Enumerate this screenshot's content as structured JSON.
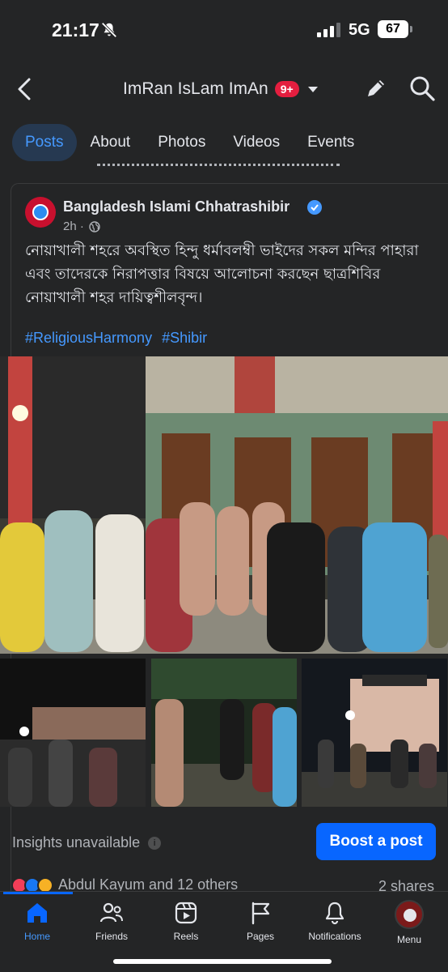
{
  "status": {
    "time": "21:17",
    "network": "5G",
    "battery": "67"
  },
  "header": {
    "title": "ImRan IsLam ImAn",
    "badge": "9+"
  },
  "tabs": [
    "Posts",
    "About",
    "Photos",
    "Videos",
    "Events"
  ],
  "post": {
    "author": "Bangladesh Islami Chhatrashibir",
    "time": "2h ·",
    "text": "নোয়াখালী শহরে অবস্থিত হিন্দু ধর্মাবলম্বী ভাইদের সকল মন্দির পাহারা এবং তাদেরকে নিরাপত্তার বিষয়ে আলোচনা করছেন ছাত্রশিবির নোয়াখালী শহর দায়িত্বশীলবৃন্দ।",
    "hashtags": [
      "#ReligiousHarmony",
      "#Shibir"
    ]
  },
  "insights": {
    "text": "Insights unavailable",
    "boost_label": "Boost a post"
  },
  "reactions": {
    "text": "Abdul Kayum and 12 others",
    "shares": "2 shares"
  },
  "nav": {
    "items": [
      {
        "label": "Home",
        "icon": "home-icon"
      },
      {
        "label": "Friends",
        "icon": "friends-icon"
      },
      {
        "label": "Reels",
        "icon": "reels-icon"
      },
      {
        "label": "Pages",
        "icon": "flag-icon"
      },
      {
        "label": "Notifications",
        "icon": "bell-icon"
      },
      {
        "label": "Menu",
        "icon": "avatar"
      }
    ]
  },
  "colors": {
    "accent": "#0866ff",
    "link": "#4599ff",
    "background": "#242526"
  }
}
